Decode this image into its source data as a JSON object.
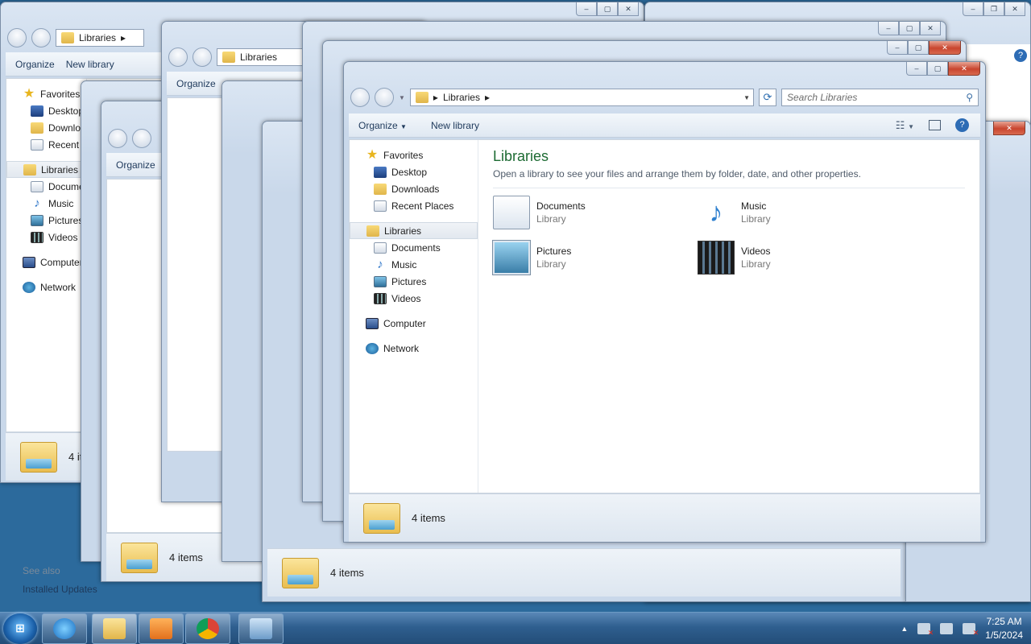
{
  "windows": {
    "breadcrumb": "Libraries",
    "search_placeholder": "Search Libraries",
    "organize_label": "Organize",
    "new_library_label": "New library",
    "status_text": "4 items",
    "nav": {
      "favorites": "Favorites",
      "desktop": "Desktop",
      "downloads": "Downloads",
      "recent_places": "Recent Places",
      "libraries": "Libraries",
      "documents": "Documents",
      "music": "Music",
      "pictures": "Pictures",
      "videos": "Videos",
      "computer": "Computer",
      "network": "Network"
    },
    "content": {
      "title": "Libraries",
      "description": "Open a library to see your files and arrange them by folder, date, and other properties.",
      "libraries": [
        {
          "name": "Documents",
          "type": "Library",
          "icon": "documents-library-icon"
        },
        {
          "name": "Music",
          "type": "Library",
          "icon": "music-library-icon"
        },
        {
          "name": "Pictures",
          "type": "Library",
          "icon": "pictures-library-icon"
        },
        {
          "name": "Videos",
          "type": "Library",
          "icon": "videos-library-icon"
        }
      ]
    }
  },
  "back_window": {
    "see_also": "See also",
    "installed_updates": "Installed Updates"
  },
  "taskbar": {
    "time": "7:25 AM",
    "date": "1/5/2024",
    "apps": [
      "explorer-icon",
      "internet-explorer-icon",
      "windows-explorer-icon",
      "media-player-icon",
      "chrome-icon",
      "control-panel-icon"
    ]
  },
  "colors": {
    "accent_title": "#1d6b33",
    "close_button": "#c9452f",
    "taskbar": "#2f5f8f"
  }
}
